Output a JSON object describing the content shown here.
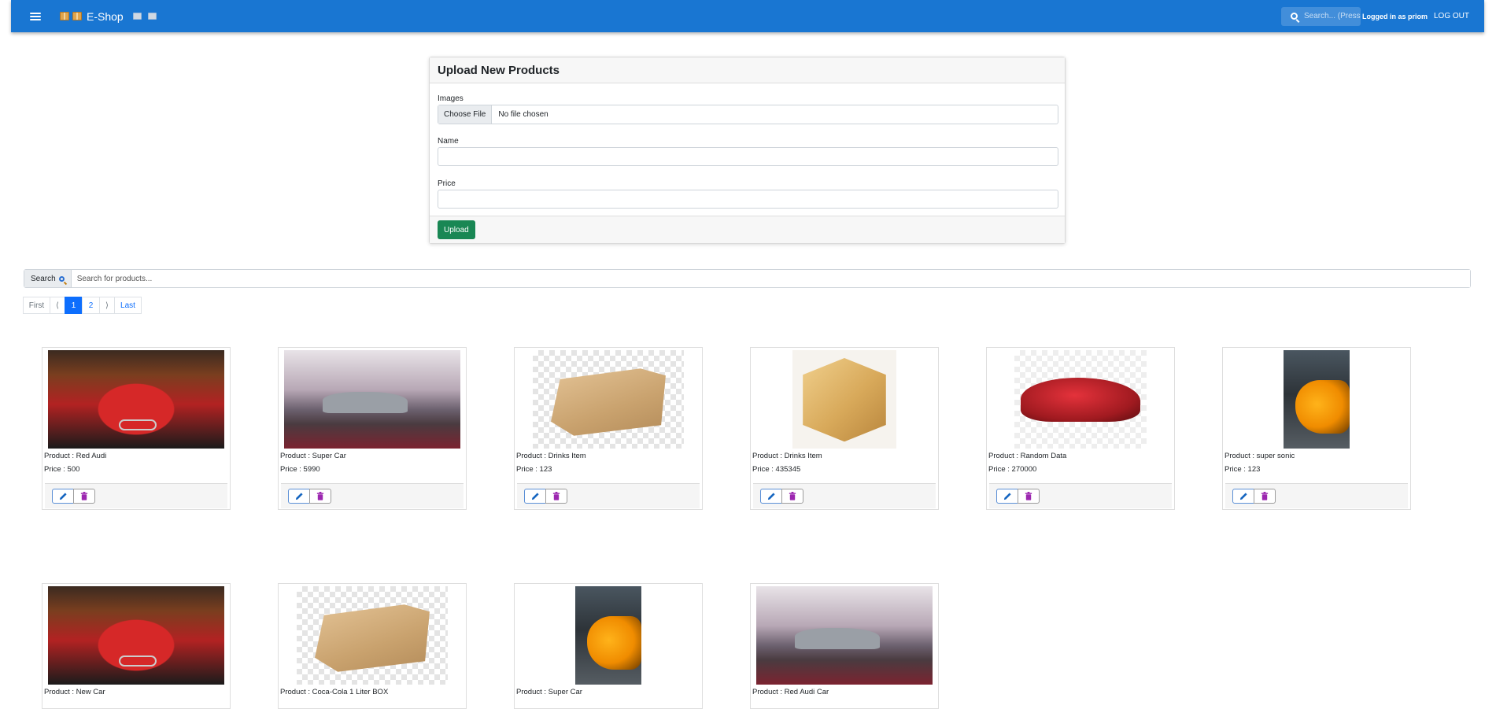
{
  "appbar": {
    "title": "E-Shop",
    "search_placeholder": "Search... (Press /)",
    "logged_in_text": "Logged in as priom",
    "logout_label": "LOG OUT",
    "color": "#1976d2"
  },
  "upload_form": {
    "title": "Upload New Products",
    "images_label": "Images",
    "choose_file_label": "Choose File",
    "no_file_text": "No file chosen",
    "name_label": "Name",
    "name_value": "",
    "price_label": "Price",
    "price_value": "",
    "upload_label": "Upload",
    "upload_color": "#198754"
  },
  "product_search": {
    "label": "Search",
    "placeholder": "Search for products...",
    "value": ""
  },
  "pagination": {
    "first_label": "First",
    "prev_label": "⟨",
    "pages": [
      "1",
      "2"
    ],
    "current_page": "1",
    "next_label": "⟩",
    "last_label": "Last"
  },
  "products": [
    {
      "name": "Product : Red Audi",
      "price": "Price : 500",
      "image": "red-audi-car"
    },
    {
      "name": "Product : Super Car",
      "price": "Price : 5990",
      "image": "silver-super-car"
    },
    {
      "name": "Product : Drinks Item",
      "price": "Price : 123",
      "image": "cardboard-box"
    },
    {
      "name": "Product : Drinks Item",
      "price": "Price : 435345",
      "image": "shipping-box"
    },
    {
      "name": "Product : Random Data",
      "price": "Price : 270000",
      "image": "red-sports-car"
    },
    {
      "name": "Product : super sonic",
      "price": "Price : 123",
      "image": "yellow-sports-car"
    },
    {
      "name": "Product : New Car",
      "price": "",
      "image": "red-audi-car"
    },
    {
      "name": "Product : Coca-Cola 1 Liter BOX",
      "price": "",
      "image": "cardboard-box"
    },
    {
      "name": "Product : Super Car",
      "price": "",
      "image": "yellow-sports-car"
    },
    {
      "name": "Product : Red Audi Car",
      "price": "",
      "image": "silver-super-car"
    }
  ],
  "icons": {
    "edit": "pencil-icon",
    "delete": "trash-icon",
    "menu": "hamburger-menu-icon",
    "search": "search-icon"
  }
}
